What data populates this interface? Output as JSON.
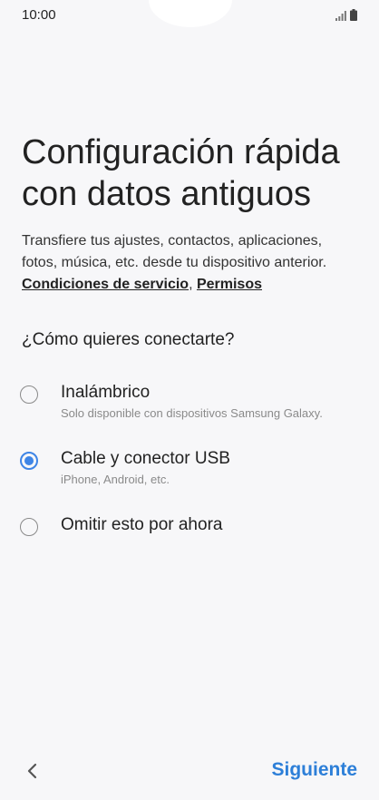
{
  "status_bar": {
    "time": "10:00"
  },
  "title": {
    "line1": "Configuración rápida",
    "line2": "con datos antiguos"
  },
  "description": {
    "line1": "Transfiere tus ajustes, contactos, aplicaciones,",
    "line2": "fotos, música, etc. desde tu dispositivo anterior.",
    "terms_link": "Condiciones de servicio",
    "separator": ", ",
    "permissions_link": "Permisos"
  },
  "question": "¿Cómo quieres conectarte?",
  "options": [
    {
      "label": "Inalámbrico",
      "sublabel": "Solo disponible con dispositivos Samsung Galaxy.",
      "selected": false
    },
    {
      "label": "Cable y conector USB",
      "sublabel": "iPhone, Android, etc.",
      "selected": true
    },
    {
      "label": "Omitir esto por ahora",
      "sublabel": "",
      "selected": false
    }
  ],
  "footer": {
    "back_icon": "chevron-left-icon",
    "next_label": "Siguiente"
  },
  "colors": {
    "accent": "#3e85e6",
    "next_button": "#2d7fd8",
    "background": "#f7f7f9"
  }
}
